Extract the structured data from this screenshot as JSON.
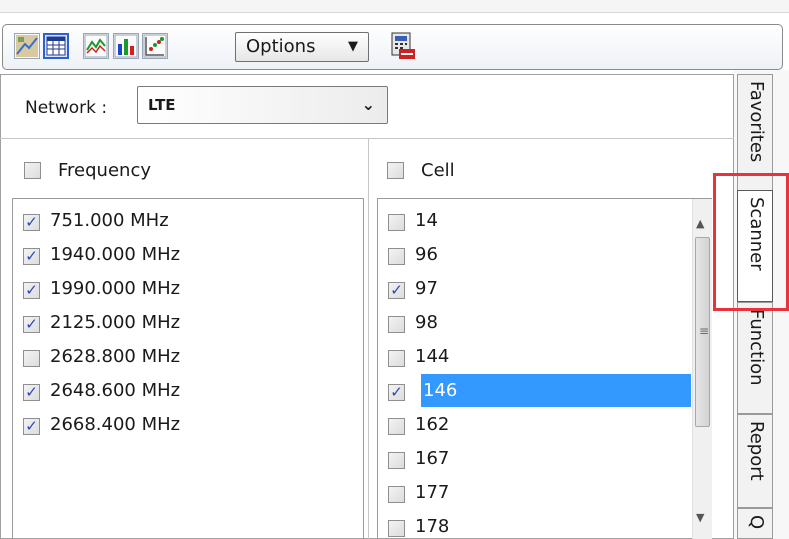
{
  "toolbar": {
    "buttons": [
      {
        "icon": "map-icon",
        "active": false
      },
      {
        "icon": "grid-table-icon",
        "active": true
      },
      {
        "icon": "line-graph-icon",
        "active": false
      },
      {
        "icon": "bar-chart-icon",
        "active": false
      },
      {
        "icon": "scatter-plot-icon",
        "active": false
      }
    ],
    "options_label": "Options",
    "export_icon": "export-calculator-icon"
  },
  "network": {
    "label": "Network :",
    "value": "LTE"
  },
  "frequency": {
    "header": "Frequency",
    "items": [
      {
        "label": "751.000 MHz",
        "checked": true
      },
      {
        "label": "1940.000 MHz",
        "checked": true
      },
      {
        "label": "1990.000 MHz",
        "checked": true
      },
      {
        "label": "2125.000 MHz",
        "checked": true
      },
      {
        "label": "2628.800 MHz",
        "checked": false
      },
      {
        "label": "2648.600 MHz",
        "checked": true
      },
      {
        "label": "2668.400 MHz",
        "checked": true
      }
    ]
  },
  "cell": {
    "header": "Cell",
    "items": [
      {
        "label": "14",
        "checked": false,
        "selected": false
      },
      {
        "label": "96",
        "checked": false,
        "selected": false
      },
      {
        "label": "97",
        "checked": true,
        "selected": false
      },
      {
        "label": "98",
        "checked": false,
        "selected": false
      },
      {
        "label": "144",
        "checked": false,
        "selected": false
      },
      {
        "label": "146",
        "checked": true,
        "selected": true
      },
      {
        "label": "162",
        "checked": false,
        "selected": false
      },
      {
        "label": "167",
        "checked": false,
        "selected": false
      },
      {
        "label": "177",
        "checked": false,
        "selected": false
      },
      {
        "label": "178",
        "checked": false,
        "selected": false
      }
    ]
  },
  "side_tabs": [
    {
      "label": "Favorites",
      "active": false
    },
    {
      "label": "Scanner",
      "active": true
    },
    {
      "label": "Function",
      "active": false
    },
    {
      "label": "Report",
      "active": false
    },
    {
      "label": "Q",
      "active": false
    }
  ],
  "colors": {
    "selection": "#3399ff",
    "highlight_box": "#e8323c",
    "checkmark": "#2d46b4"
  }
}
